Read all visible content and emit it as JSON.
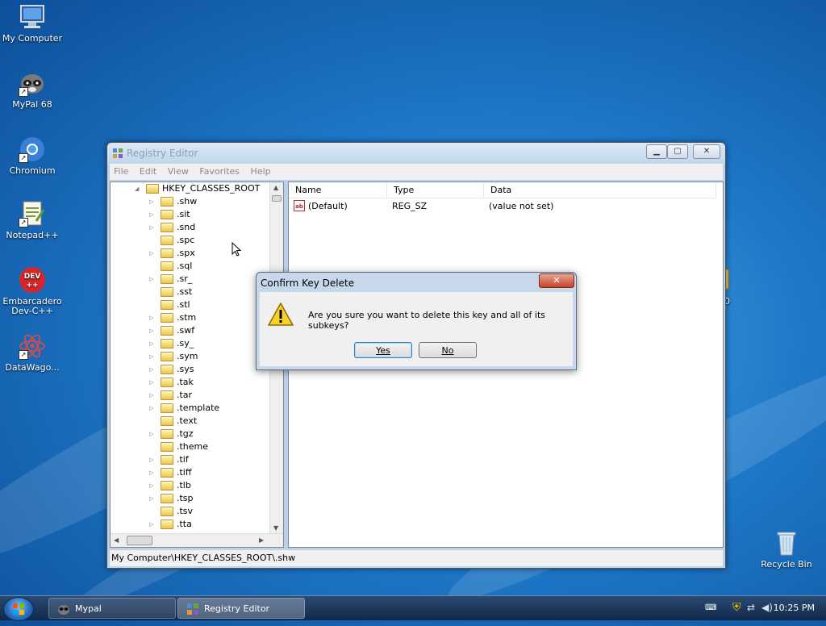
{
  "desktop": {
    "icons": [
      {
        "label": "My Computer"
      },
      {
        "label": "MyPal 68"
      },
      {
        "label": "Chromium"
      },
      {
        "label": "Notepad++"
      },
      {
        "label": "Embarcadero Dev-C++"
      },
      {
        "label": "DataWago..."
      },
      {
        "label": "Recycle Bin"
      },
      {
        "label": "g0"
      }
    ]
  },
  "regedit": {
    "title": "Registry Editor",
    "menu": [
      "File",
      "Edit",
      "View",
      "Favorites",
      "Help"
    ],
    "tree": {
      "root": "HKEY_CLASSES_ROOT",
      "items": [
        ".shw",
        ".sit",
        ".snd",
        ".spc",
        ".spx",
        ".sql",
        ".sr_",
        ".sst",
        ".stl",
        ".stm",
        ".swf",
        ".sy_",
        ".sym",
        ".sys",
        ".tak",
        ".tar",
        ".template",
        ".text",
        ".tgz",
        ".theme",
        ".tif",
        ".tiff",
        ".tlb",
        ".tsp",
        ".tsv",
        ".tta"
      ]
    },
    "columns": {
      "name": "Name",
      "type": "Type",
      "data": "Data"
    },
    "values": [
      {
        "name": "(Default)",
        "type": "REG_SZ",
        "data": "(value not set)"
      }
    ],
    "status_path": "My Computer\\HKEY_CLASSES_ROOT\\.shw"
  },
  "dialog": {
    "title": "Confirm Key Delete",
    "message": "Are you sure you want to delete this key and all of its subkeys?",
    "yes_label": "Yes",
    "no_label": "No"
  },
  "taskbar": {
    "tasks": [
      {
        "label": "Mypal"
      },
      {
        "label": "Registry Editor"
      }
    ],
    "clock": "10:25 PM"
  }
}
